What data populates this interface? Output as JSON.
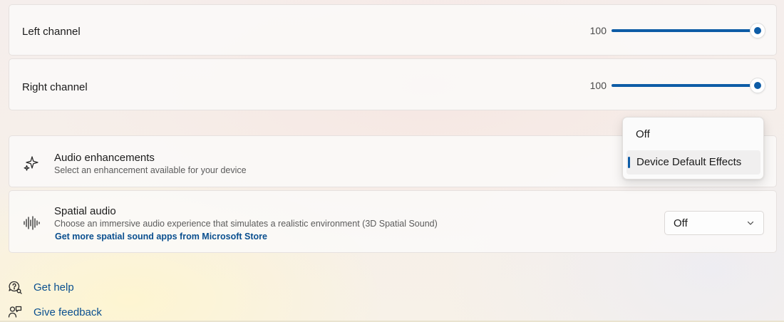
{
  "channels": [
    {
      "label": "Left channel",
      "value": "100",
      "level": 1.0
    },
    {
      "label": "Right channel",
      "value": "100",
      "level": 1.0
    }
  ],
  "audio_enhancements": {
    "icon": "sparkle-icon",
    "title": "Audio enhancements",
    "subtitle": "Select an enhancement available for your device",
    "dropdown": {
      "options": [
        "Off",
        "Device Default Effects"
      ],
      "selected": "Device Default Effects"
    }
  },
  "spatial_audio": {
    "icon": "sound-wave-icon",
    "title": "Spatial audio",
    "subtitle": "Choose an immersive audio experience that simulates a realistic environment (3D Spatial Sound)",
    "link": "Get more spatial sound apps from Microsoft Store",
    "select_value": "Off"
  },
  "footer": {
    "help": {
      "label": "Get help",
      "icon": "help-chat-icon"
    },
    "feedback": {
      "label": "Give feedback",
      "icon": "feedback-person-icon"
    }
  },
  "colors": {
    "accent": "#0d5ca6",
    "link": "#0a4f8f"
  }
}
